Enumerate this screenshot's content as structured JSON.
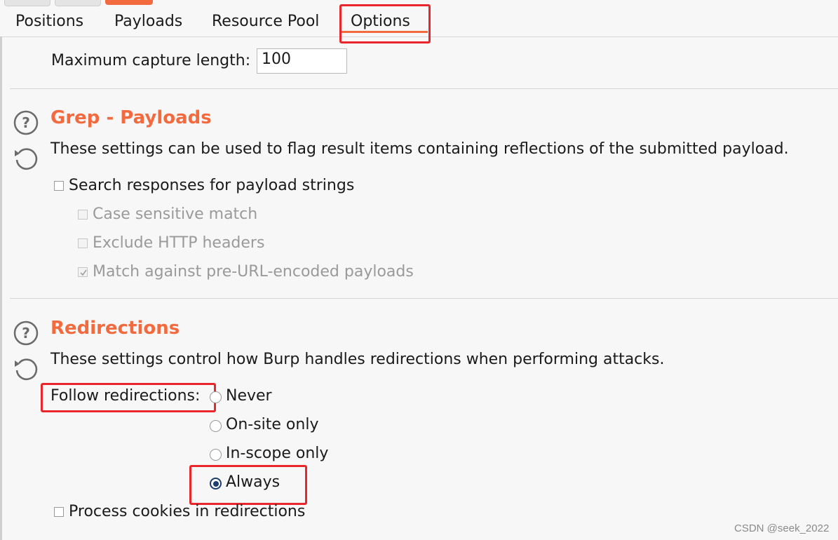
{
  "tabs": {
    "items": [
      "Positions",
      "Payloads",
      "Resource Pool",
      "Options"
    ],
    "active": "Options"
  },
  "capture": {
    "label": "Maximum capture length:",
    "value": "100"
  },
  "grep_payloads": {
    "title": "Grep - Payloads",
    "description": "These settings can be used to flag result items containing reflections of the submitted payload.",
    "search_label": "Search responses for payload strings",
    "search_checked": false,
    "case_label": "Case sensitive match",
    "case_checked": false,
    "exclude_label": "Exclude HTTP headers",
    "exclude_checked": false,
    "match_label": "Match against pre-URL-encoded payloads",
    "match_checked": true
  },
  "redirections": {
    "title": "Redirections",
    "description": "These settings control how Burp handles redirections when performing attacks.",
    "follow_label": "Follow redirections:",
    "options": [
      "Never",
      "On-site only",
      "In-scope only",
      "Always"
    ],
    "selected": "Always",
    "cookies_label": "Process cookies in redirections",
    "cookies_checked": false
  },
  "icons": {
    "help": "help-question-icon",
    "reset": "reset-defaults-icon"
  },
  "colors": {
    "accent": "#f26a3d",
    "highlight": "#e8262c",
    "radio_selected": "#1d3f6e"
  },
  "watermark": "CSDN @seek_2022"
}
